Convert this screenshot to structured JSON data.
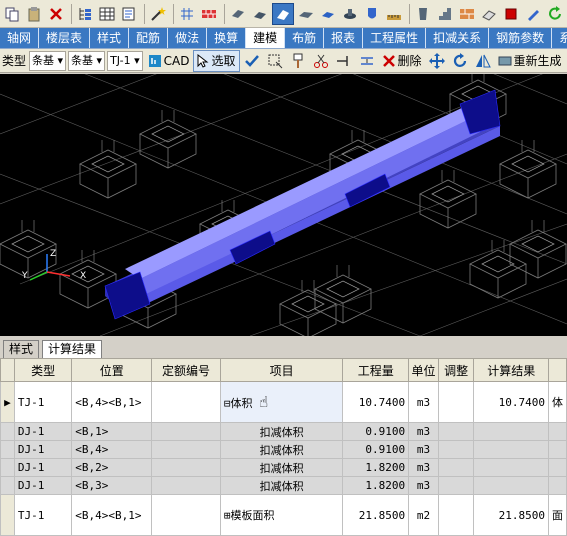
{
  "ribbon_tabs": [
    "轴网",
    "楼层表",
    "样式",
    "配筋",
    "做法",
    "换算",
    "建模",
    "布筋",
    "报表",
    "工程属性",
    "扣减关系",
    "钢筋参数",
    "系"
  ],
  "active_tab": "建模",
  "toolbar2": {
    "type_label": "类型",
    "type_value": "条基",
    "subtype_value": "条基",
    "name_value": "TJ-1",
    "cad_label": "CAD",
    "select_label": "选取",
    "delete_label": "删除",
    "regen_label": "重新生成"
  },
  "panel_tabs": [
    "样式",
    "计算结果"
  ],
  "active_panel_tab": "计算结果",
  "table": {
    "headers": [
      "类型",
      "位置",
      "定额编号",
      "项目",
      "工程量",
      "单位",
      "调整",
      "计算结果"
    ],
    "rows": [
      {
        "type": "TJ-1",
        "pos": "<B,4><B,1>",
        "code": "",
        "item": "⊟体积",
        "qty": "10.7400",
        "unit": "m3",
        "adj": "",
        "result": "10.7400",
        "extra": "体",
        "kind": "main"
      },
      {
        "type": "DJ-1",
        "pos": "<B,1>",
        "code": "",
        "item": "扣减体积",
        "qty": "0.9100",
        "unit": "m3",
        "adj": "",
        "result": "",
        "extra": "",
        "kind": "sub"
      },
      {
        "type": "DJ-1",
        "pos": "<B,4>",
        "code": "",
        "item": "扣减体积",
        "qty": "0.9100",
        "unit": "m3",
        "adj": "",
        "result": "",
        "extra": "",
        "kind": "sub"
      },
      {
        "type": "DJ-1",
        "pos": "<B,2>",
        "code": "",
        "item": "扣减体积",
        "qty": "1.8200",
        "unit": "m3",
        "adj": "",
        "result": "",
        "extra": "",
        "kind": "sub"
      },
      {
        "type": "DJ-1",
        "pos": "<B,3>",
        "code": "",
        "item": "扣减体积",
        "qty": "1.8200",
        "unit": "m3",
        "adj": "",
        "result": "",
        "extra": "",
        "kind": "sub"
      },
      {
        "type": "TJ-1",
        "pos": "<B,4><B,1>",
        "code": "",
        "item": "⊞模板面积",
        "qty": "21.8500",
        "unit": "m2",
        "adj": "",
        "result": "21.8500",
        "extra": "面",
        "kind": "main"
      }
    ]
  },
  "colors": {
    "tab_blue": "#3a78c2",
    "viewport": "#000000",
    "beam": "#8a8aff"
  },
  "axis_labels": {
    "x": "X",
    "y": "Y",
    "z": "Z"
  }
}
